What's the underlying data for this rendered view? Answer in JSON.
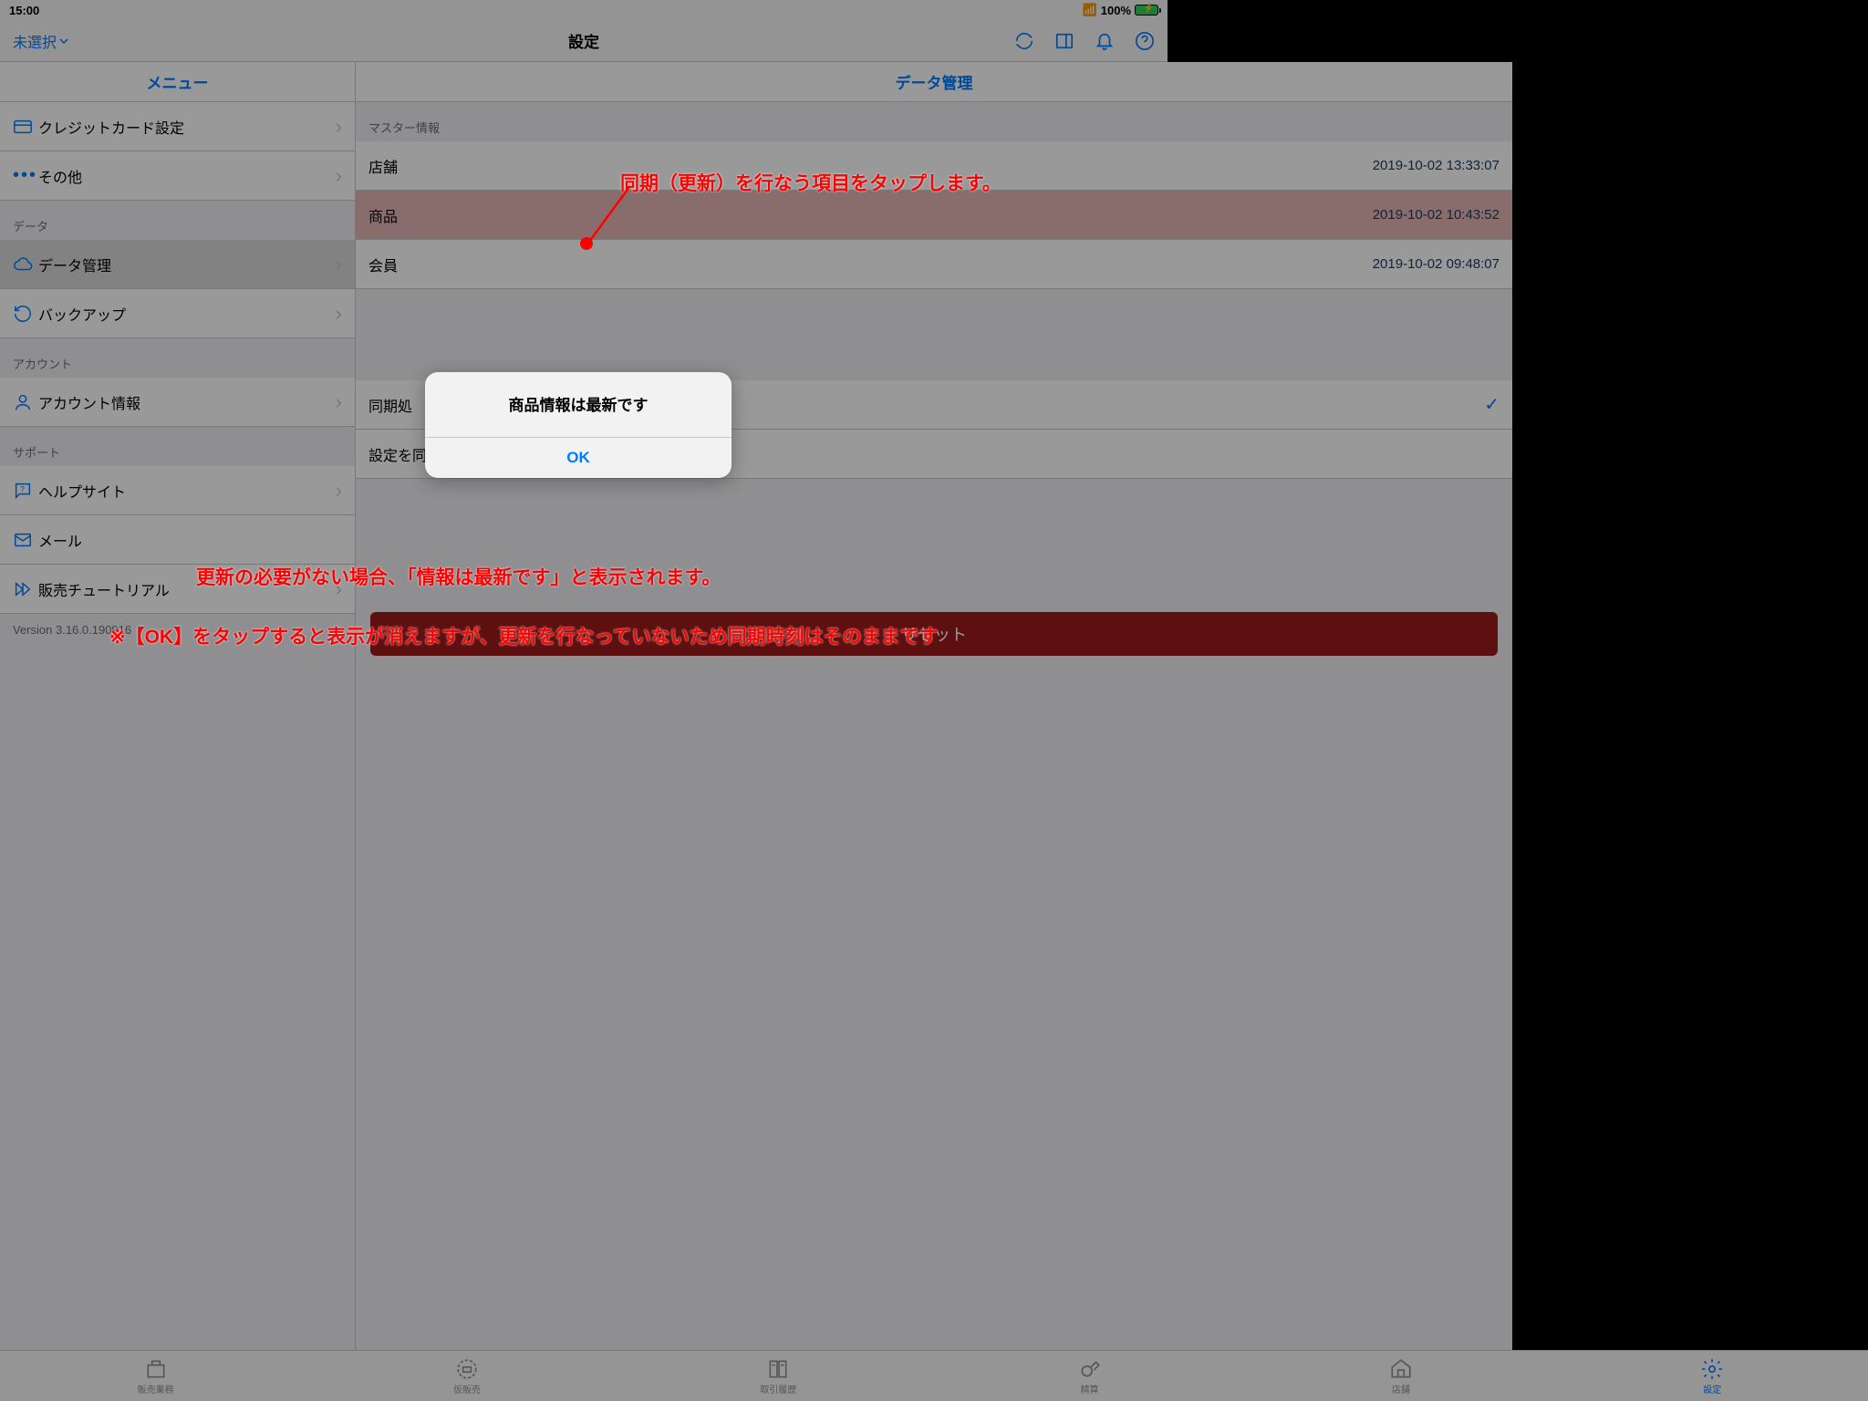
{
  "status": {
    "time": "15:00",
    "battery": "100%"
  },
  "nav": {
    "left": "未選択",
    "title": "設定"
  },
  "menu": {
    "title": "メニュー",
    "items": {
      "credit": "クレジットカード設定",
      "other": "その他",
      "section_data": "データ",
      "data_mgmt": "データ管理",
      "backup": "バックアップ",
      "section_account": "アカウント",
      "account_info": "アカウント情報",
      "section_support": "サポート",
      "help": "ヘルプサイト",
      "mail": "メール",
      "tutorial": "販売チュートリアル"
    },
    "version": "Version 3.16.0.190916"
  },
  "detail": {
    "title": "データ管理",
    "section_master": "マスター情報",
    "rows": {
      "store": {
        "label": "店舗",
        "ts": "2019-10-02 13:33:07"
      },
      "product": {
        "label": "商品",
        "ts": "2019-10-02 10:43:52"
      },
      "member": {
        "label": "会員",
        "ts": "2019-10-02 09:48:07"
      }
    },
    "sync_proc": "同期処",
    "sync_settings": "設定を同期する",
    "reset": "リセット"
  },
  "alert": {
    "title": "商品情報は最新です",
    "ok": "OK"
  },
  "tabs": {
    "sales": "販売業務",
    "temp": "仮販売",
    "history": "取引履歴",
    "checkout": "精算",
    "store": "店舗",
    "settings": "設定"
  },
  "annotations": {
    "tap": "同期（更新）を行なう項目をタップします。",
    "uptodate": "更新の必要がない場合、「情報は最新です」と表示されます。",
    "note": "※【OK】をタップすると表示が消えますが、更新を行なっていないため同期時刻はそのままです"
  }
}
